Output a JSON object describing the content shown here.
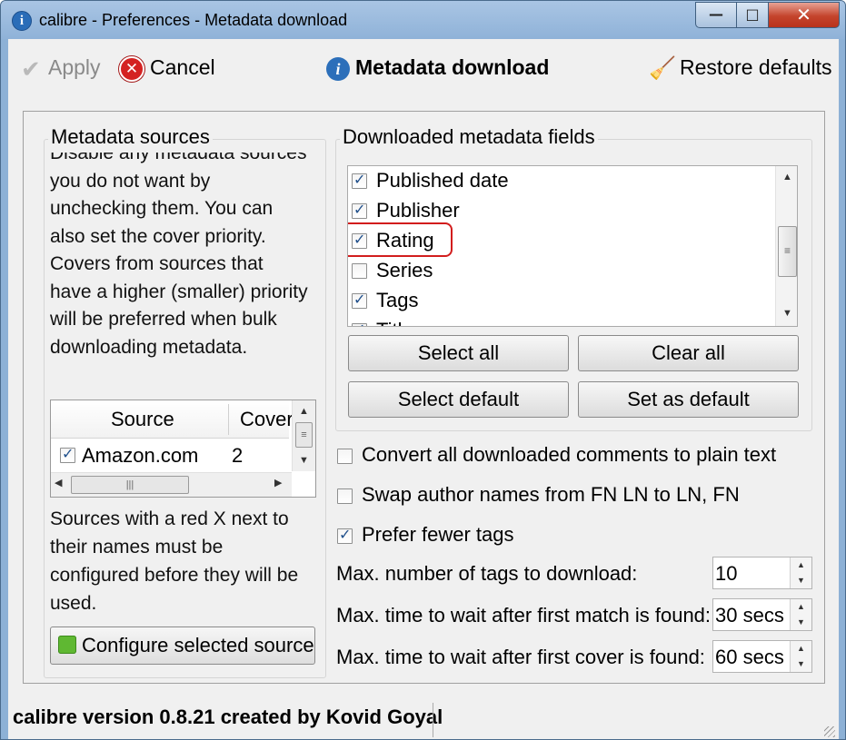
{
  "window": {
    "title": "calibre - Preferences - Metadata download",
    "app_icon": "info-i",
    "controls": {
      "minimize": "—",
      "maximize": "□",
      "close": "✕"
    }
  },
  "toolbar": {
    "apply_label": "Apply",
    "cancel_label": "Cancel",
    "heading": "Metadata download",
    "restore_label": "Restore defaults"
  },
  "sources": {
    "title": "Metadata sources",
    "description_lines": [
      "Disable any metadata sources",
      "you do not want by",
      "unchecking them. You can",
      "also set the cover priority.",
      "Covers from sources that",
      "have a higher (smaller) priority",
      "will be preferred when bulk",
      "downloading metadata."
    ],
    "table": {
      "columns": [
        "Source",
        "Cover"
      ],
      "rows": [
        {
          "checked": true,
          "source": "Amazon.com",
          "cover": "2"
        }
      ]
    },
    "note_lines": [
      "Sources with a red X next to",
      "their names must be",
      "configured before they will be",
      "used."
    ],
    "configure_button": "Configure selected source"
  },
  "fields": {
    "title": "Downloaded metadata fields",
    "items": [
      {
        "label": "Published date",
        "checked": true
      },
      {
        "label": "Publisher",
        "checked": true
      },
      {
        "label": "Rating",
        "checked": true,
        "highlighted": true
      },
      {
        "label": "Series",
        "checked": false
      },
      {
        "label": "Tags",
        "checked": true
      },
      {
        "label": "Title",
        "checked": true
      }
    ],
    "buttons": {
      "select_all": "Select all",
      "clear_all": "Clear all",
      "select_default": "Select default",
      "set_default": "Set as default"
    }
  },
  "options": {
    "plain_text": {
      "label": "Convert all downloaded comments to plain text",
      "checked": false
    },
    "swap_author": {
      "label": "Swap author names from FN LN to LN, FN",
      "checked": false
    },
    "fewer_tags": {
      "label": "Prefer fewer tags",
      "checked": true
    }
  },
  "spinners": {
    "max_tags": {
      "label": "Max. number of tags to download:",
      "value": "10"
    },
    "wait_match": {
      "label": "Max. time to wait after first match is found:",
      "value": "30 secs"
    },
    "wait_cover": {
      "label": "Max. time to wait after first cover is found:",
      "value": "60 secs"
    }
  },
  "status": {
    "text": "calibre version 0.8.21 created by Kovid Goyal"
  },
  "colors": {
    "titlebar": "#8fb2d8",
    "close_button": "#c4442c",
    "highlight_outline": "#d21d1d",
    "dialog_bg": "#f0f0f0"
  }
}
